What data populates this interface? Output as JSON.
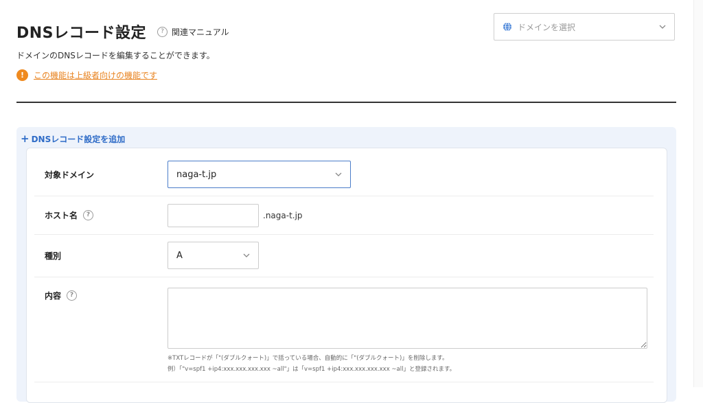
{
  "header": {
    "title": "DNSレコード設定",
    "manual_link": "関連マニュアル",
    "description": "ドメインのDNSレコードを編集することができます。",
    "warning": "この機能は上級者向けの機能です"
  },
  "domain_picker": {
    "placeholder": "ドメインを選択",
    "icon": "globe-icon"
  },
  "panel": {
    "add_label": "DNSレコード設定を追加"
  },
  "form": {
    "target_domain_label": "対象ドメイン",
    "target_domain_value": "naga-t.jp",
    "host_label": "ホスト名",
    "host_value": "",
    "host_suffix": ".naga-t.jp",
    "type_label": "種別",
    "type_value": "A",
    "content_label": "内容",
    "content_value": "",
    "note_1": "※TXTレコードが「\"(ダブルクォート)」で括っている場合、自動的に「\"(ダブルクォート)」を削除します。",
    "note_2": "例）「\"v=spf1 +ip4:xxx.xxx.xxx.xxx ~all\"」は「v=spf1 +ip4:xxx.xxx.xxx.xxx ~all」と登録されます。"
  },
  "colors": {
    "accent_blue": "#2f6cc7",
    "warning_orange": "#ef8a1f",
    "panel_bg": "#eef3fb"
  }
}
